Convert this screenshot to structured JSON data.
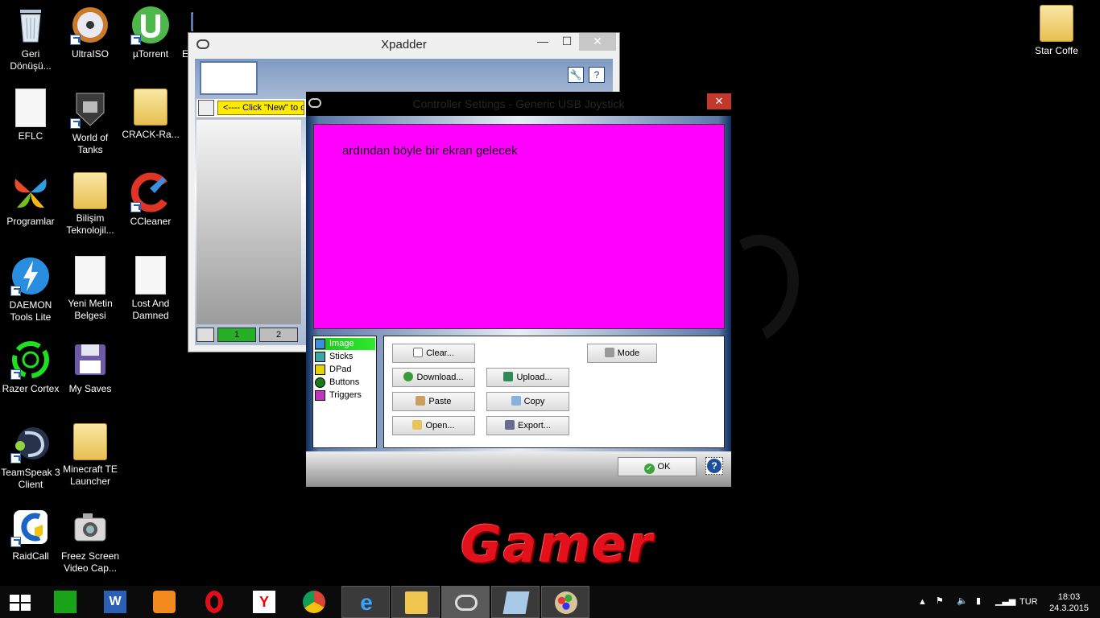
{
  "desktop": {
    "icons": [
      {
        "label": "Geri Dönüşü...",
        "icon": "recycle-bin-icon"
      },
      {
        "label": "UltraISO",
        "icon": "disc-icon"
      },
      {
        "label": "µTorrent",
        "icon": "utorrent-icon"
      },
      {
        "label": "E",
        "icon": "app-icon"
      },
      {
        "label": "EFLC",
        "icon": "document-icon"
      },
      {
        "label": "World of Tanks",
        "icon": "tank-icon"
      },
      {
        "label": "CRACK-Ra...",
        "icon": "folder-icon"
      },
      {
        "label": "Programlar",
        "icon": "msn-butterfly-icon"
      },
      {
        "label": "Bilişim Teknolojil...",
        "icon": "folder-icon"
      },
      {
        "label": "CCleaner",
        "icon": "ccleaner-icon"
      },
      {
        "label": "DAEMON Tools Lite",
        "icon": "daemon-tools-icon"
      },
      {
        "label": "Yeni Metin Belgesi",
        "icon": "document-icon"
      },
      {
        "label": "Lost And Damned",
        "icon": "document-icon"
      },
      {
        "label": "Razer Cortex",
        "icon": "razer-cortex-icon"
      },
      {
        "label": "My Saves",
        "icon": "floppy-icon"
      },
      {
        "label": "TeamSpeak 3 Client",
        "icon": "teamspeak-icon"
      },
      {
        "label": "Minecraft TE Launcher",
        "icon": "folder-icon"
      },
      {
        "label": "RaidCall",
        "icon": "raidcall-icon"
      },
      {
        "label": "Freez Screen Video Cap...",
        "icon": "camera-icon"
      },
      {
        "label": "Star Coffe",
        "icon": "folder-icon"
      }
    ],
    "wallpaper_text": "Gamer"
  },
  "xpadder": {
    "title": "Xpadder",
    "min_label": "—",
    "max_label": "☐",
    "close_label": "✕",
    "new_hint": "<---- Click \"New\" to cr",
    "page1": "1",
    "page2": "2",
    "tools_icon": "wrench-icon",
    "help_icon": "help-icon"
  },
  "controller_settings": {
    "title": "Controller Settings - Generic   USB  Joystick",
    "close_label": "✕",
    "canvas_text": "ardından böyle bir ekran gelecek",
    "canvas_color": "#ff00ff",
    "categories": [
      {
        "label": "Image",
        "selected": true,
        "color": "#3b8fd9"
      },
      {
        "label": "Sticks",
        "selected": false,
        "color": "#3aa6a6"
      },
      {
        "label": "DPad",
        "selected": false,
        "color": "#e5d400"
      },
      {
        "label": "Buttons",
        "selected": false,
        "color": "#1a7a1a"
      },
      {
        "label": "Triggers",
        "selected": false,
        "color": "#c233c2"
      }
    ],
    "buttons": {
      "clear": "Clear...",
      "mode": "Mode",
      "download": "Download...",
      "upload": "Upload...",
      "paste": "Paste",
      "copy": "Copy",
      "open": "Open...",
      "export": "Export..."
    },
    "ok_label": "OK",
    "help_label": "?"
  },
  "taskbar": {
    "apps": [
      "Store",
      "Word",
      "Media Player",
      "Opera",
      "Yandex",
      "Chrome",
      "Internet Explorer",
      "File Explorer",
      "Xpadder",
      "Notepad",
      "Paint"
    ],
    "language": "TUR",
    "time": "18:03",
    "date": "24.3.2015"
  }
}
